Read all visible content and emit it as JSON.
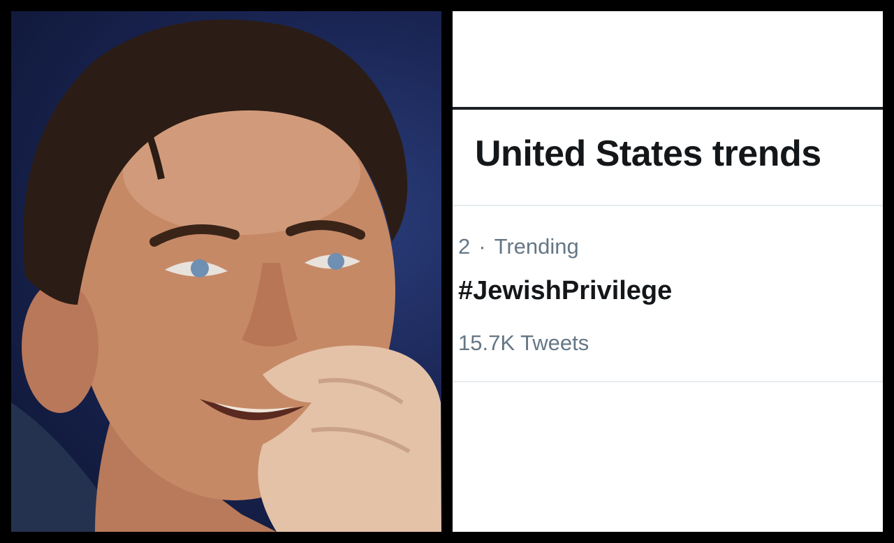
{
  "trends": {
    "title": "United States trends",
    "items": [
      {
        "rank": "2",
        "separator": "·",
        "context": "Trending",
        "name": "#JewishPrivilege",
        "tweet_count": "15.7K Tweets"
      }
    ]
  },
  "colors": {
    "background": "#000000",
    "panel": "#ffffff",
    "title_text": "#14171a",
    "secondary_text": "#657786",
    "divider": "#e6ecf0"
  }
}
